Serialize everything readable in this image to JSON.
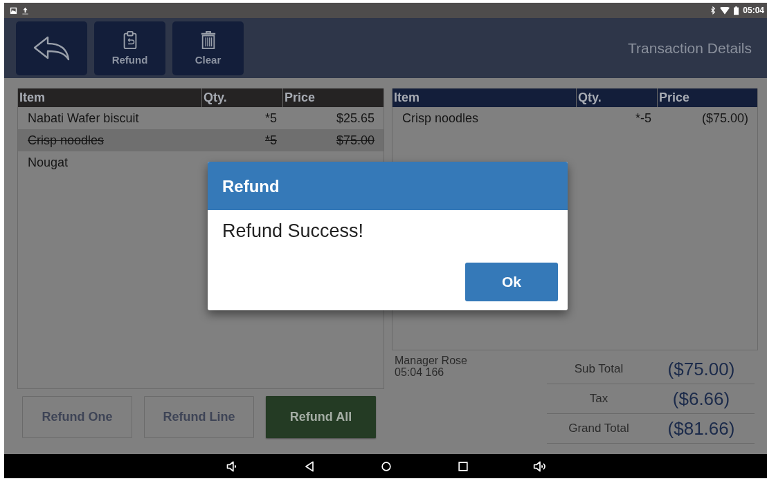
{
  "status_bar": {
    "time": "05:04"
  },
  "header": {
    "buttons": [
      {
        "kind": "back"
      },
      {
        "kind": "refund",
        "label": "Refund"
      },
      {
        "kind": "clear",
        "label": "Clear"
      }
    ],
    "title": "Transaction Details"
  },
  "sale_table": {
    "columns": [
      "Item",
      "Qty.",
      "Price"
    ],
    "rows": [
      {
        "item": "Nabati Wafer biscuit",
        "qty": "*5",
        "price": "$25.65",
        "refunded": false
      },
      {
        "item": "Crisp noodles",
        "qty": "*5",
        "price": "$75.00",
        "refunded": true
      },
      {
        "item": "Nougat",
        "refunded": false
      }
    ]
  },
  "action_buttons": [
    {
      "label": "Refund One",
      "disabled": true
    },
    {
      "label": "Refund Line",
      "disabled": true
    },
    {
      "label": "Refund All",
      "disabled": false
    }
  ],
  "refund_table": {
    "columns": [
      "Item",
      "Qty.",
      "Price"
    ],
    "rows": [
      {
        "item": "Crisp noodles",
        "qty": "*-5",
        "price": "($75.00)"
      }
    ]
  },
  "operator": {
    "name": "Manager Rose",
    "time_id": "05:04 166"
  },
  "totals": [
    {
      "label": "Sub Total",
      "value": "($75.00)"
    },
    {
      "label": "Tax",
      "value": "($6.66)"
    },
    {
      "label": "Grand Total",
      "value": "($81.66)"
    }
  ],
  "dialog": {
    "title": "Refund",
    "message": "Refund Success!",
    "button": "Ok"
  }
}
